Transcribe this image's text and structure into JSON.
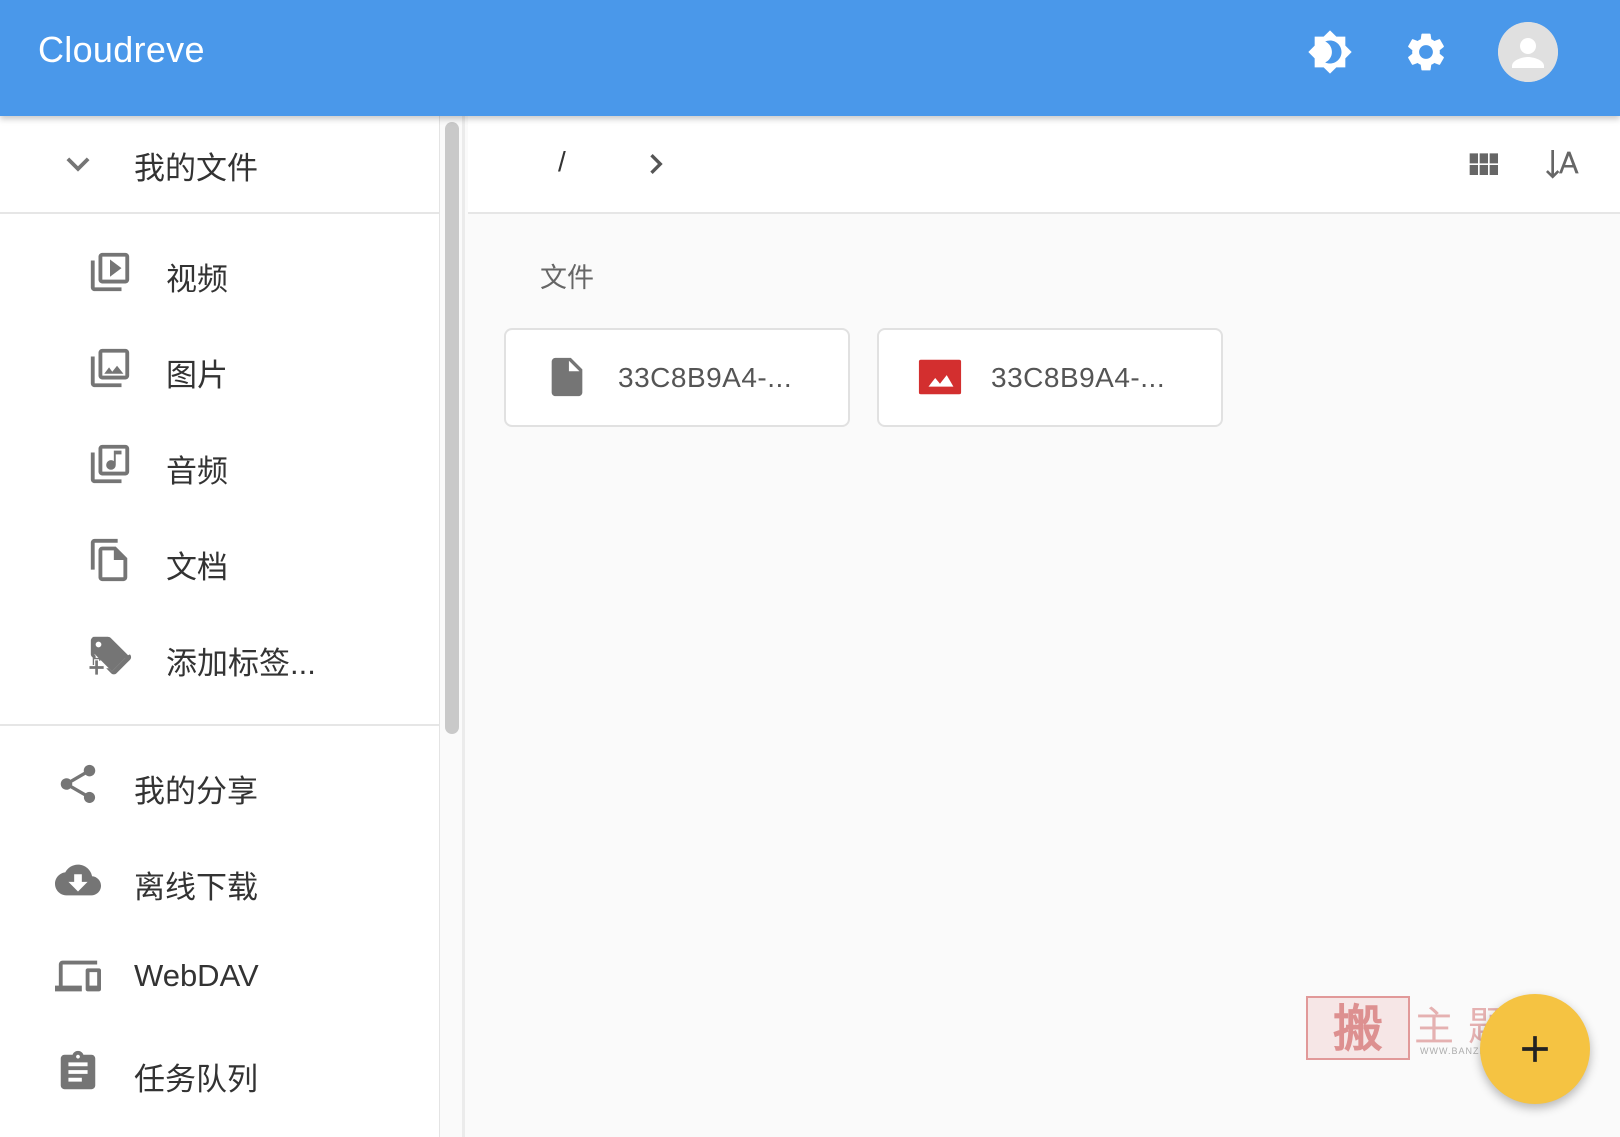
{
  "app": {
    "title": "Cloudreve"
  },
  "header": {
    "icons": [
      "brightness-icon",
      "settings-icon",
      "avatar-icon"
    ],
    "colors": {
      "appbar": "#4a98ea"
    }
  },
  "sidebar": {
    "my_files": {
      "label": "我的文件",
      "icon": "chevron-down-icon"
    },
    "categories": [
      {
        "label": "视频",
        "icon": "video-library-icon"
      },
      {
        "label": "图片",
        "icon": "photo-library-icon"
      },
      {
        "label": "音频",
        "icon": "music-library-icon"
      },
      {
        "label": "文档",
        "icon": "file-copy-icon"
      },
      {
        "label": "添加标签...",
        "icon": "add-tag-icon"
      }
    ],
    "items": [
      {
        "label": "我的分享",
        "icon": "share-icon"
      },
      {
        "label": "离线下载",
        "icon": "cloud-download-icon"
      },
      {
        "label": "WebDAV",
        "icon": "devices-icon"
      },
      {
        "label": "任务队列",
        "icon": "assignment-icon"
      }
    ]
  },
  "toolbar": {
    "path": "/",
    "icons": [
      "chevron-right-icon",
      "grid-view-icon",
      "sort-alpha-icon"
    ]
  },
  "main": {
    "section_title": "文件",
    "files": [
      {
        "name": "33C8B9A4-...",
        "icon": "file-icon",
        "icon_color": "#757575"
      },
      {
        "name": "33C8B9A4-...",
        "icon": "image-icon",
        "icon_color": "#d32f2f"
      }
    ]
  },
  "watermark": {
    "stamp": "搬",
    "text": "主题",
    "url": "WWW.BANZHUTI.COM"
  },
  "fab": {
    "icon": "add-icon",
    "color": "#f5c342"
  }
}
